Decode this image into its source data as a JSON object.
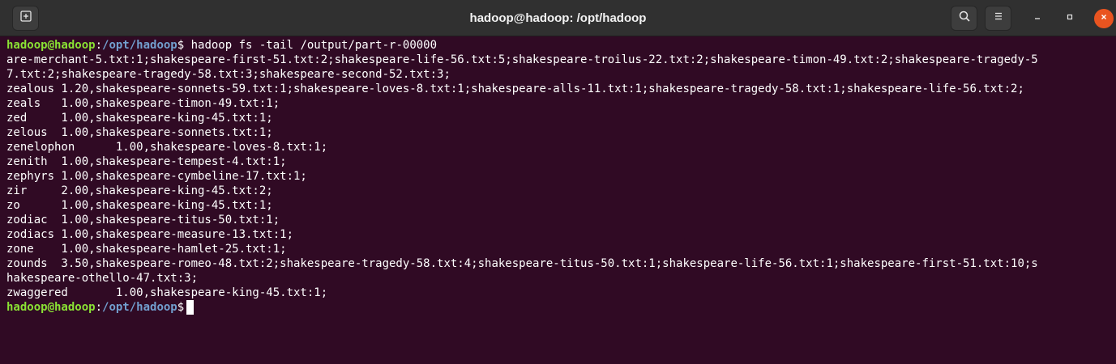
{
  "window": {
    "title": "hadoop@hadoop: /opt/hadoop"
  },
  "titlebar": {
    "icons": [
      "new-tab-icon",
      "search-icon",
      "hamburger-menu-icon",
      "minimize-icon",
      "maximize-icon",
      "close-icon"
    ]
  },
  "colors": {
    "terminal_bg": "#300a24",
    "titlebar_bg": "#303030",
    "prompt_user": "#8ae234",
    "prompt_path": "#729fcf",
    "close_accent": "#e95420"
  },
  "terminal": {
    "prompt1": {
      "user": "hadoop@hadoop",
      "sep": ":",
      "path": "/opt/hadoop",
      "symbol": "$ ",
      "command": "hadoop fs -tail /output/part-r-00000"
    },
    "output": [
      "are-merchant-5.txt:1;shakespeare-first-51.txt:2;shakespeare-life-56.txt:5;shakespeare-troilus-22.txt:2;shakespeare-timon-49.txt:2;shakespeare-tragedy-5",
      "7.txt:2;shakespeare-tragedy-58.txt:3;shakespeare-second-52.txt:3;",
      "zealous 1.20,shakespeare-sonnets-59.txt:1;shakespeare-loves-8.txt:1;shakespeare-alls-11.txt:1;shakespeare-tragedy-58.txt:1;shakespeare-life-56.txt:2;",
      "zeals   1.00,shakespeare-timon-49.txt:1;",
      "zed     1.00,shakespeare-king-45.txt:1;",
      "zelous  1.00,shakespeare-sonnets.txt:1;",
      "zenelophon      1.00,shakespeare-loves-8.txt:1;",
      "zenith  1.00,shakespeare-tempest-4.txt:1;",
      "zephyrs 1.00,shakespeare-cymbeline-17.txt:1;",
      "zir     2.00,shakespeare-king-45.txt:2;",
      "zo      1.00,shakespeare-king-45.txt:1;",
      "zodiac  1.00,shakespeare-titus-50.txt:1;",
      "zodiacs 1.00,shakespeare-measure-13.txt:1;",
      "zone    1.00,shakespeare-hamlet-25.txt:1;",
      "zounds  3.50,shakespeare-romeo-48.txt:2;shakespeare-tragedy-58.txt:4;shakespeare-titus-50.txt:1;shakespeare-life-56.txt:1;shakespeare-first-51.txt:10;s",
      "hakespeare-othello-47.txt:3;",
      "zwaggered       1.00,shakespeare-king-45.txt:1;"
    ],
    "prompt2": {
      "user": "hadoop@hadoop",
      "sep": ":",
      "path": "/opt/hadoop",
      "symbol": "$",
      "command": ""
    }
  }
}
